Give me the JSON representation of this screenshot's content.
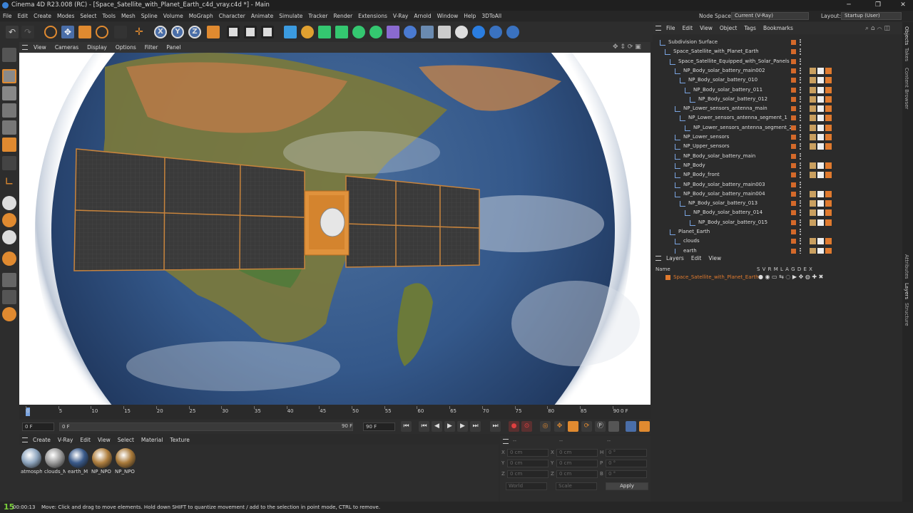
{
  "window": {
    "title": "Cinema 4D R23.008 (RC) - [Space_Satellite_with_Planet_Earth_c4d_vray.c4d *] - Main",
    "minimize": "─",
    "maximize": "❐",
    "close": "✕"
  },
  "menu": [
    "File",
    "Edit",
    "Create",
    "Modes",
    "Select",
    "Tools",
    "Mesh",
    "Spline",
    "Volume",
    "MoGraph",
    "Character",
    "Animate",
    "Simulate",
    "Tracker",
    "Render",
    "Extensions",
    "V-Ray",
    "Arnold",
    "Window",
    "Help",
    "3DToAll"
  ],
  "node_space": {
    "label": "Node Space:",
    "value": "Current (V-Ray)"
  },
  "layout": {
    "label": "Layout:",
    "value": "Startup (User)"
  },
  "toolbar": {
    "x": "X",
    "y": "Y",
    "z": "Z"
  },
  "viewport_menu": [
    "View",
    "Cameras",
    "Display",
    "Options",
    "Filter",
    "Panel"
  ],
  "timeline": {
    "ticks": [
      "0",
      "5",
      "10",
      "15",
      "20",
      "25",
      "30",
      "35",
      "40",
      "45",
      "50",
      "55",
      "60",
      "65",
      "70",
      "75",
      "80",
      "85",
      "90"
    ],
    "current_frame": "0 F"
  },
  "playbar": {
    "start": "0 F",
    "range_start": "0 F",
    "range_end": "90 F",
    "end": "90 F"
  },
  "material_menu": [
    "Create",
    "V-Ray",
    "Edit",
    "View",
    "Select",
    "Material",
    "Texture"
  ],
  "materials": [
    {
      "name": "atmosph",
      "color": "#8fa6bf"
    },
    {
      "name": "clouds_N",
      "color": "#9b9b9b"
    },
    {
      "name": "earth_M",
      "color": "#3a5a8a"
    },
    {
      "name": "NP_NPO",
      "color": "#b08040"
    },
    {
      "name": "NP_NPO",
      "color": "#a97a3a"
    }
  ],
  "coordinates": {
    "top_labels": [
      "--",
      "--",
      "--"
    ],
    "rows": [
      {
        "a": "X",
        "av": "0 cm",
        "b": "X",
        "bv": "0 cm",
        "c": "H",
        "cv": "0 °"
      },
      {
        "a": "Y",
        "av": "0 cm",
        "b": "Y",
        "bv": "0 cm",
        "c": "P",
        "cv": "0 °"
      },
      {
        "a": "Z",
        "av": "0 cm",
        "b": "Z",
        "bv": "0 cm",
        "c": "B",
        "cv": "0 °"
      }
    ],
    "mode1": "World",
    "mode2": "Scale",
    "apply": "Apply"
  },
  "status": {
    "fps": "15",
    "time": "00:00:13",
    "message": "Move: Click and drag to move elements. Hold down SHIFT to quantize movement / add to the selection in point mode, CTRL to remove."
  },
  "objects_menu": [
    "File",
    "Edit",
    "View",
    "Object",
    "Tags",
    "Bookmarks"
  ],
  "objects": [
    {
      "name": "Subdivision Surface",
      "indent": 0,
      "tags": 0
    },
    {
      "name": "Space_Satellite_with_Planet_Earth",
      "indent": 1,
      "tags": 0
    },
    {
      "name": "Space_Satellite_Equipped_with_Solar_Panels",
      "indent": 2,
      "tags": 0
    },
    {
      "name": "NP_Body_solar_battery_main002",
      "indent": 3,
      "tags": 3
    },
    {
      "name": "NP_Body_solar_battery_010",
      "indent": 4,
      "tags": 3
    },
    {
      "name": "NP_Body_solar_battery_011",
      "indent": 5,
      "tags": 3
    },
    {
      "name": "NP_Body_solar_battery_012",
      "indent": 6,
      "tags": 3
    },
    {
      "name": "NP_Lower_sensors_antenna_main",
      "indent": 3,
      "tags": 3
    },
    {
      "name": "NP_Lower_sensors_antenna_segment_1",
      "indent": 4,
      "tags": 3
    },
    {
      "name": "NP_Lower_sensors_antenna_segment_2",
      "indent": 5,
      "tags": 3
    },
    {
      "name": "NP_Lower_sensors",
      "indent": 3,
      "tags": 3
    },
    {
      "name": "NP_Upper_sensors",
      "indent": 3,
      "tags": 3
    },
    {
      "name": "NP_Body_solar_battery_main",
      "indent": 3,
      "tags": 0
    },
    {
      "name": "NP_Body",
      "indent": 3,
      "tags": 3
    },
    {
      "name": "NP_Body_front",
      "indent": 3,
      "tags": 3
    },
    {
      "name": "NP_Body_solar_battery_main003",
      "indent": 3,
      "tags": 0
    },
    {
      "name": "NP_Body_solar_battery_main004",
      "indent": 3,
      "tags": 3
    },
    {
      "name": "NP_Body_solar_battery_013",
      "indent": 4,
      "tags": 3
    },
    {
      "name": "NP_Body_solar_battery_014",
      "indent": 5,
      "tags": 3
    },
    {
      "name": "NP_Body_solar_battery_015",
      "indent": 6,
      "tags": 3
    },
    {
      "name": "Planet_Earth",
      "indent": 2,
      "tags": 0
    },
    {
      "name": "clouds",
      "indent": 3,
      "tags": 3
    },
    {
      "name": "earth",
      "indent": 3,
      "tags": 3
    }
  ],
  "layers_menu": [
    "Layers",
    "Edit",
    "View"
  ],
  "layers": {
    "header_name": "Name",
    "header_flags": "S V R M L A G D E X",
    "items": [
      {
        "name": "Space_Satellite_with_Planet_Earth",
        "color": "#e07a2e"
      }
    ]
  },
  "right_tabs": [
    "Objects",
    "Takes",
    "Content Browser",
    "Attributes",
    "Layers",
    "Structure"
  ]
}
